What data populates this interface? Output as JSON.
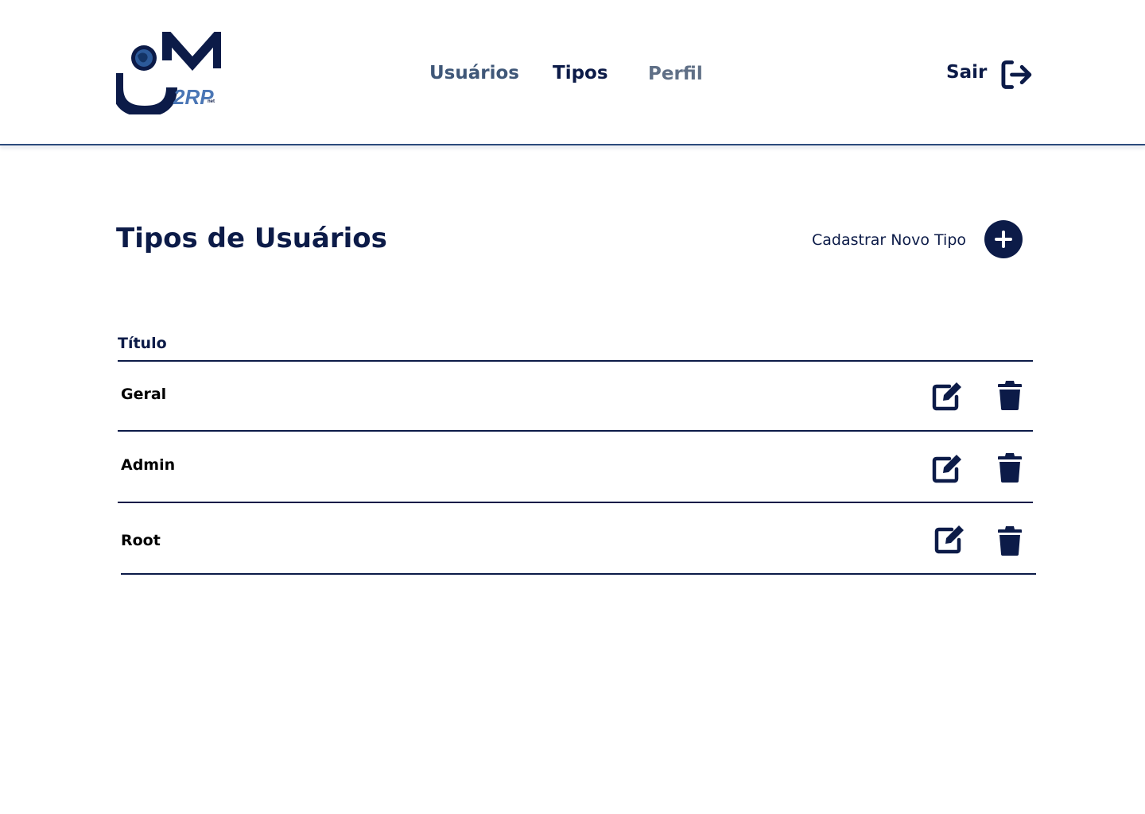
{
  "colors": {
    "primary": "#0c1b48",
    "nav_inactive": "#3f5778",
    "nav_muted": "#5f6f86",
    "logo_accent": "#4a76b5",
    "divider": "#2b4a7c"
  },
  "header": {
    "logo_text": "2RP",
    "logo_subtext": "net",
    "nav": [
      {
        "label": "Usuários",
        "active": false
      },
      {
        "label": "Tipos",
        "active": true
      },
      {
        "label": "Perfil",
        "active": false
      }
    ],
    "logout_label": "Sair",
    "logout_icon": "logout-icon"
  },
  "main": {
    "title": "Tipos de Usuários",
    "new_button_label": "Cadastrar Novo Tipo",
    "new_button_icon": "plus-icon"
  },
  "table": {
    "column_header": "Título",
    "rows": [
      {
        "label": "Geral",
        "actions": [
          "edit-icon",
          "trash-icon"
        ]
      },
      {
        "label": "Admin",
        "actions": [
          "edit-icon",
          "trash-icon"
        ]
      },
      {
        "label": "Root",
        "actions": [
          "edit-icon",
          "trash-icon"
        ]
      }
    ]
  }
}
